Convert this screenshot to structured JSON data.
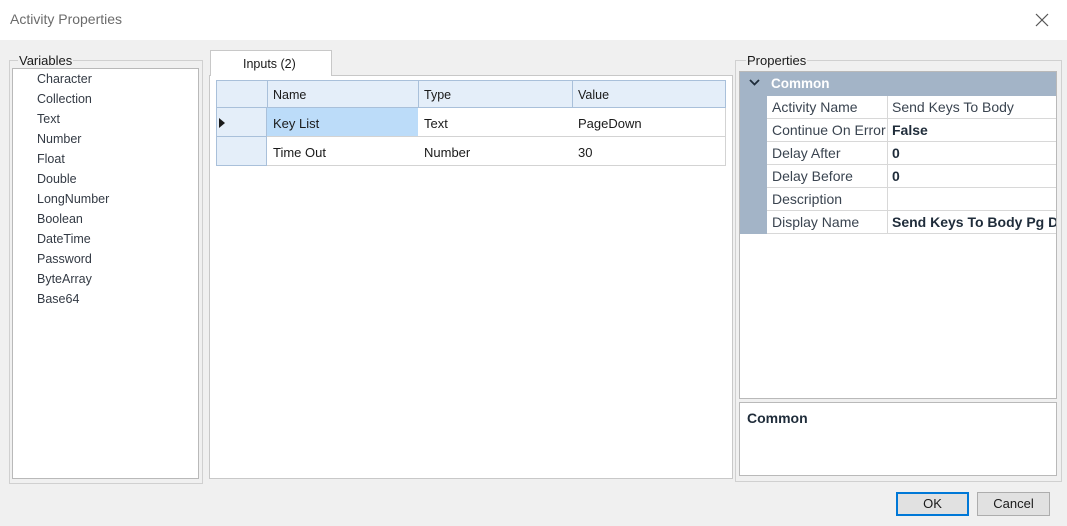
{
  "window": {
    "title": "Activity Properties"
  },
  "variables": {
    "label": "Variables",
    "items": [
      "Character",
      "Collection",
      "Text",
      "Number",
      "Float",
      "Double",
      "LongNumber",
      "Boolean",
      "DateTime",
      "Password",
      "ByteArray",
      "Base64"
    ]
  },
  "inputs": {
    "tab_label": "Inputs (2)",
    "columns": [
      "Name",
      "Type",
      "Value"
    ],
    "rows": [
      {
        "name": "Key List",
        "type": "Text",
        "value": "PageDown"
      },
      {
        "name": "Time Out",
        "type": "Number",
        "value": "30"
      }
    ]
  },
  "properties": {
    "label": "Properties",
    "category": "Common",
    "items": [
      {
        "name": "Activity Name",
        "value": "Send Keys To Body",
        "bold": false
      },
      {
        "name": "Continue On Error",
        "value": "False",
        "bold": true
      },
      {
        "name": "Delay After",
        "value": "0",
        "bold": true
      },
      {
        "name": "Delay Before",
        "value": "0",
        "bold": true
      },
      {
        "name": "Description",
        "value": "",
        "bold": false
      },
      {
        "name": "Display Name",
        "value": "Send Keys To Body Pg Dn",
        "bold": true
      }
    ],
    "description_title": "Common"
  },
  "buttons": {
    "ok": "OK",
    "cancel": "Cancel"
  },
  "icons": {
    "close": "close-icon",
    "collapse": "chevron-down-icon",
    "row_pointer": "row-pointer-icon"
  },
  "colors": {
    "header_bg": "#e4eef9",
    "selected_cell": "#bcdcf9",
    "category_bg": "#a3b4c7",
    "ok_border": "#0078d7"
  }
}
